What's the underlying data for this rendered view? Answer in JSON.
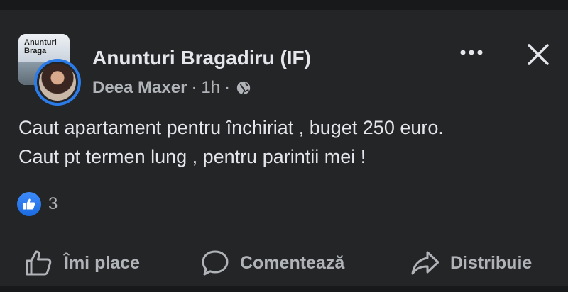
{
  "post": {
    "group_name": "Anunturi Bragadiru (IF)",
    "author": "Deea Maxer",
    "separator": "·",
    "time": "1h",
    "group_avatar_text_1": "Anunturi",
    "group_avatar_text_2": "Braga",
    "visibility_icon": "globe-icon",
    "text_line_1": "Caut apartament pentru închiriat , buget 250 euro.",
    "text_line_2": "Caut pt termen lung , pentru parintii mei !"
  },
  "reactions": {
    "icon": "like-icon",
    "count": "3"
  },
  "actions": {
    "like_label": "Îmi place",
    "comment_label": "Comentează",
    "share_label": "Distribuie"
  },
  "colors": {
    "background": "#242526",
    "text": "#e4e6eb",
    "secondary_text": "#b0b3b8",
    "accent_blue": "#2b7ce9"
  }
}
